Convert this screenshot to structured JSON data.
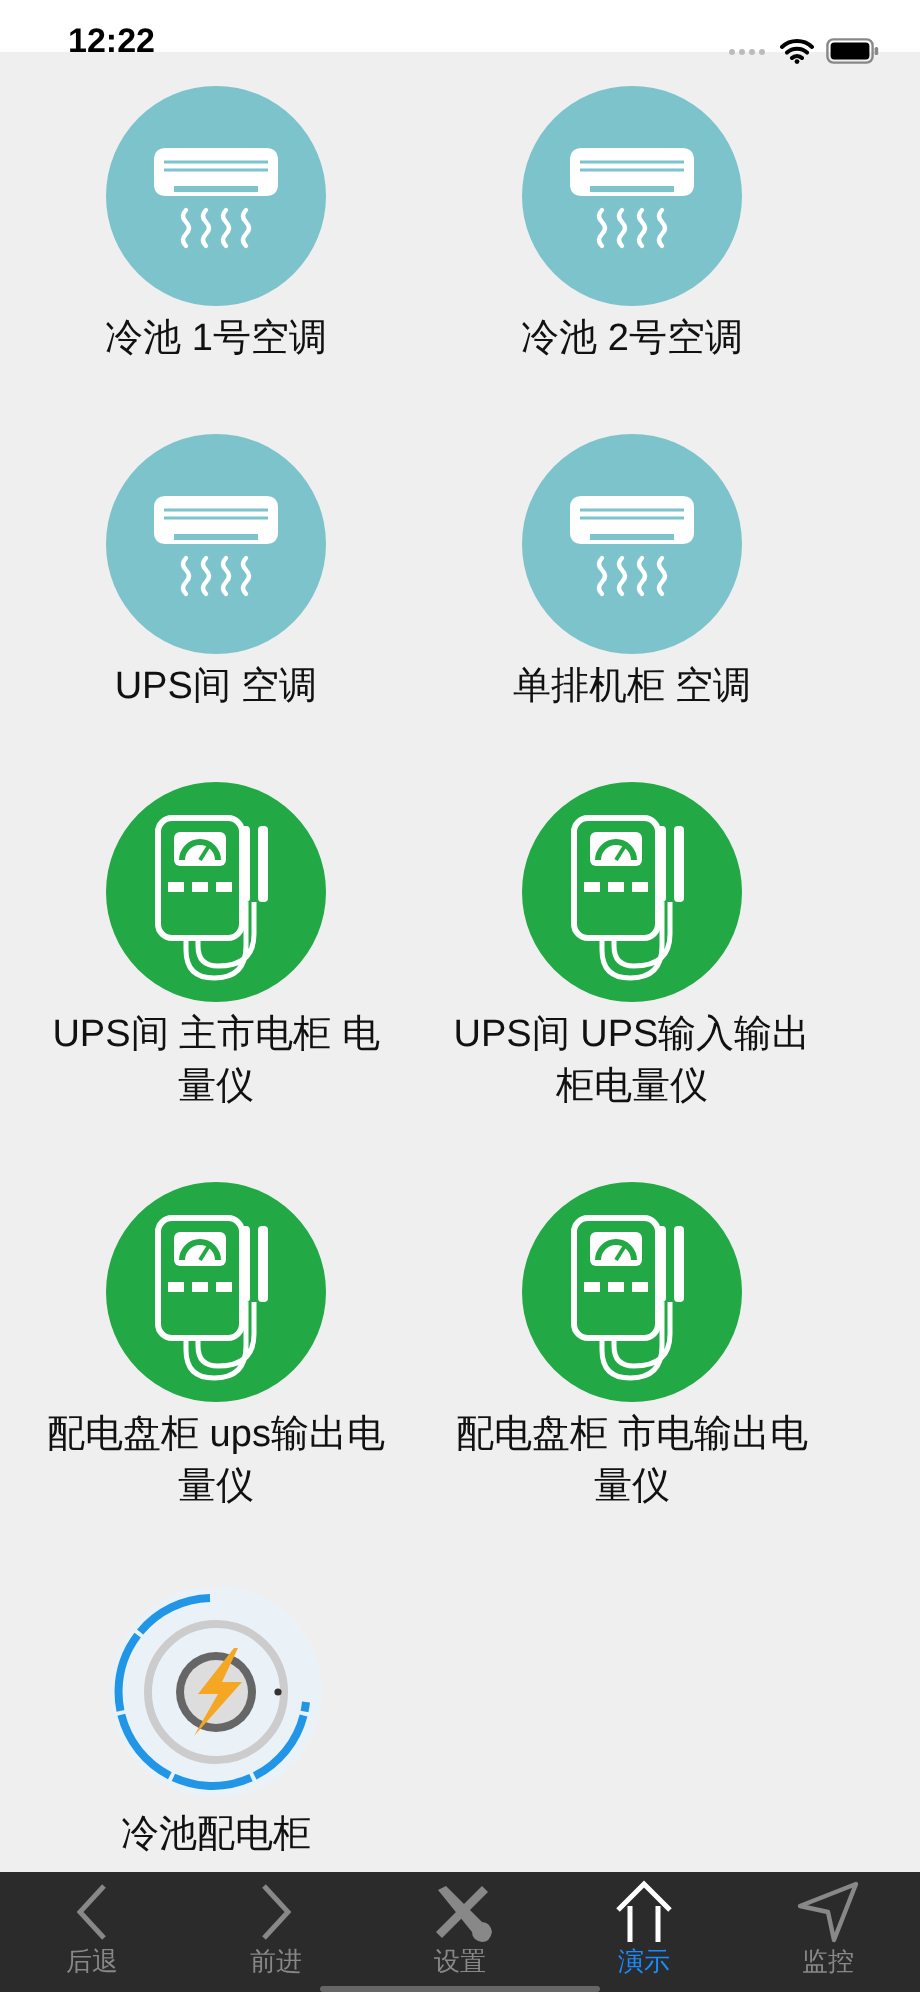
{
  "status_bar": {
    "time": "12:22"
  },
  "devices": [
    {
      "label": "冷池 1号空调",
      "kind": "aircon"
    },
    {
      "label": "冷池 2号空调",
      "kind": "aircon"
    },
    {
      "label": "UPS间 空调",
      "kind": "aircon"
    },
    {
      "label": "单排机柜 空调",
      "kind": "aircon"
    },
    {
      "label": "UPS间 主市电柜 电量仪",
      "kind": "meter"
    },
    {
      "label": "UPS间 UPS输入输出柜电量仪",
      "kind": "meter"
    },
    {
      "label": "配电盘柜 ups输出电量仪",
      "kind": "meter"
    },
    {
      "label": "配电盘柜 市电输出电量仪",
      "kind": "meter"
    },
    {
      "label": "冷池配电柜",
      "kind": "power"
    }
  ],
  "tab_bar": [
    {
      "label": "后退",
      "kind": "back",
      "selected": false
    },
    {
      "label": "前进",
      "kind": "forward",
      "selected": false
    },
    {
      "label": "设置",
      "kind": "tools",
      "selected": false
    },
    {
      "label": "演示",
      "kind": "home",
      "selected": true
    },
    {
      "label": "监控",
      "kind": "locate",
      "selected": false
    }
  ]
}
